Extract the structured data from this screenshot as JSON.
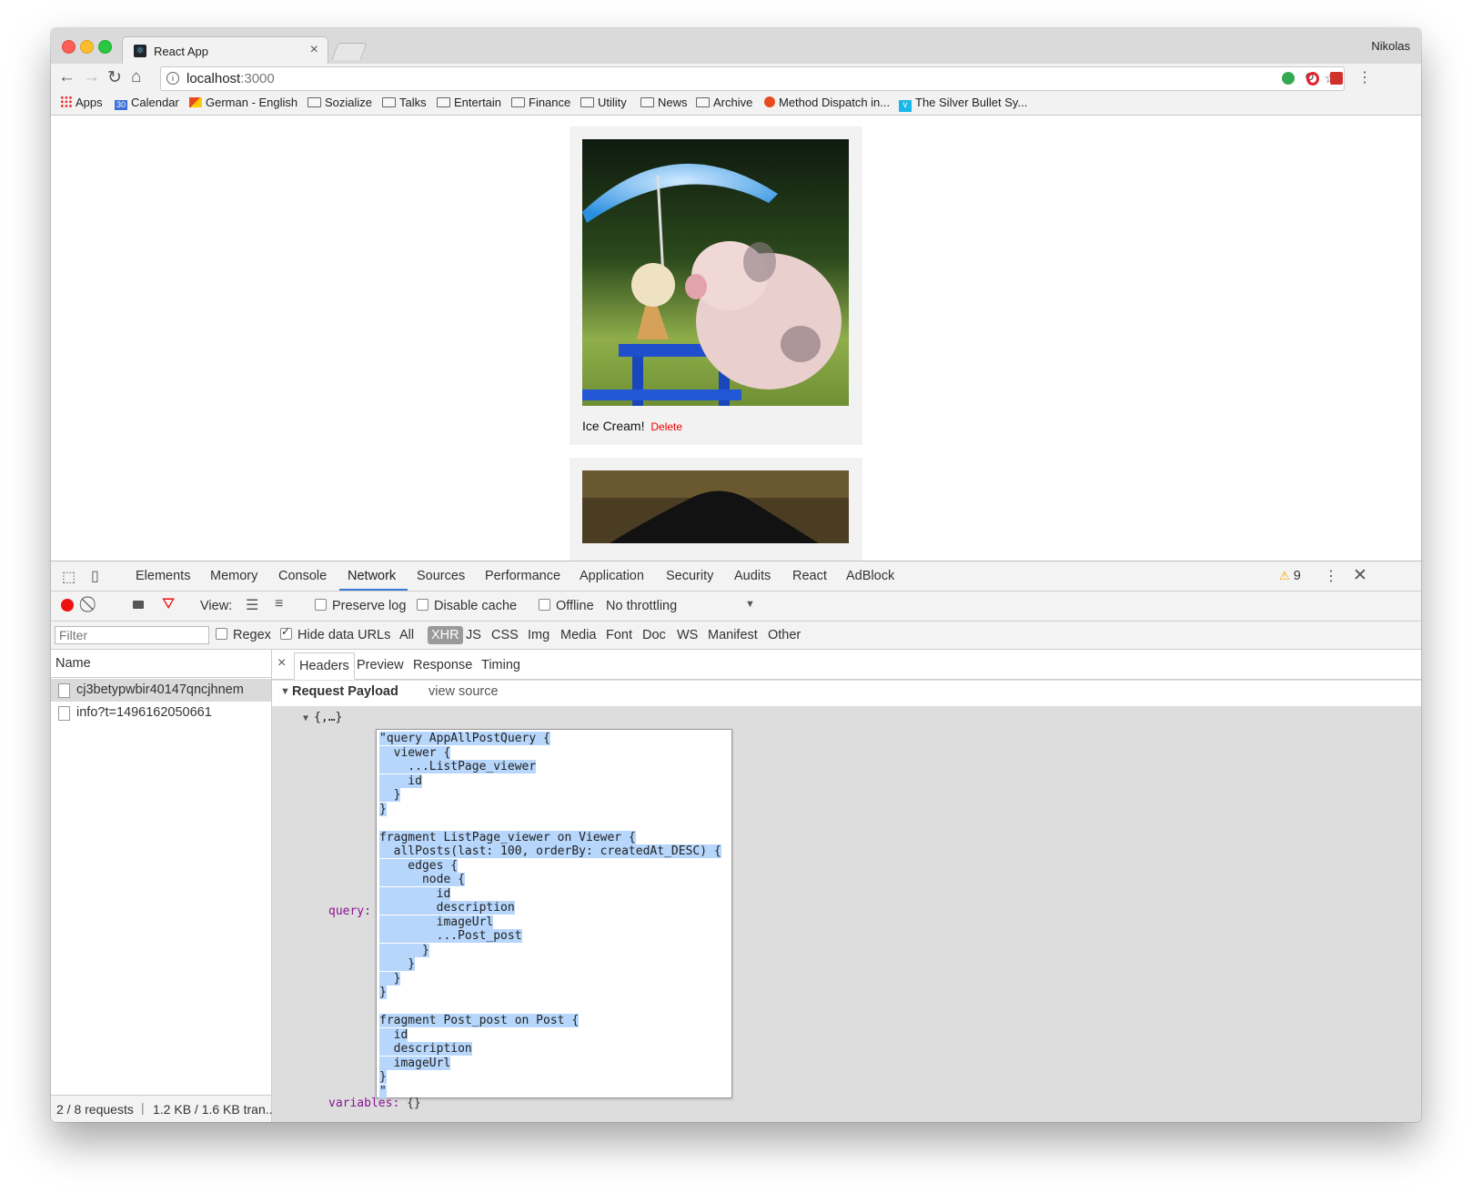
{
  "browser": {
    "tab_title": "React App",
    "profile_name": "Nikolas",
    "url_host": "localhost",
    "url_port": ":3000",
    "bookmarks": [
      {
        "label": "Apps",
        "icon": "apps-grid-icon"
      },
      {
        "label": "Calendar",
        "icon": "calendar-icon"
      },
      {
        "label": "German - English",
        "icon": "dictionary-icon"
      },
      {
        "label": "Sozialize",
        "icon": "folder-icon"
      },
      {
        "label": "Talks",
        "icon": "folder-icon"
      },
      {
        "label": "Entertain",
        "icon": "folder-icon"
      },
      {
        "label": "Finance",
        "icon": "folder-icon"
      },
      {
        "label": "Utility",
        "icon": "folder-icon"
      },
      {
        "label": "News",
        "icon": "folder-icon"
      },
      {
        "label": "Archive",
        "icon": "folder-icon"
      },
      {
        "label": "Method Dispatch in...",
        "icon": "site-icon"
      },
      {
        "label": "The Silver Bullet Sy...",
        "icon": "vimeo-icon"
      }
    ],
    "calendar_badge": "30"
  },
  "page": {
    "posts": [
      {
        "description": "Ice Cream!",
        "delete_label": "Delete"
      }
    ]
  },
  "devtools": {
    "tabs": [
      "Elements",
      "Memory",
      "Console",
      "Network",
      "Sources",
      "Performance",
      "Application",
      "Security",
      "Audits",
      "React",
      "AdBlock"
    ],
    "active_tab": "Network",
    "warning_count": "9",
    "view_label": "View:",
    "preserve_log_label": "Preserve log",
    "disable_cache_label": "Disable cache",
    "offline_label": "Offline",
    "throttling_value": "No throttling",
    "filter_placeholder": "Filter",
    "regex_label": "Regex",
    "hide_data_urls_label": "Hide data URLs",
    "type_filters": [
      "All",
      "XHR",
      "JS",
      "CSS",
      "Img",
      "Media",
      "Font",
      "Doc",
      "WS",
      "Manifest",
      "Other"
    ],
    "active_type_filter": "XHR",
    "name_header": "Name",
    "requests": [
      "cj3betypwbir40147qncjhnem",
      "info?t=1496162050661"
    ],
    "status_requests": "2 / 8 requests",
    "status_transfer": "1.2 KB / 1.6 KB tran...",
    "detail_tabs": [
      "Headers",
      "Preview",
      "Response",
      "Timing"
    ],
    "active_detail_tab": "Headers",
    "payload_title": "Request Payload",
    "view_source_label": "view source",
    "object_summary": "{,…}",
    "query_key": "query:",
    "query_lines": [
      "\"query AppAllPostQuery {",
      "  viewer {",
      "    ...ListPage_viewer",
      "    id",
      "  }",
      "}",
      "",
      "fragment ListPage_viewer on Viewer {",
      "  allPosts(last: 100, orderBy: createdAt_DESC) {",
      "    edges {",
      "      node {",
      "        id",
      "        description",
      "        imageUrl",
      "        ...Post_post",
      "      }",
      "    }",
      "  }",
      "}",
      "",
      "fragment Post_post on Post {",
      "  id",
      "  description",
      "  imageUrl",
      "}",
      "\""
    ],
    "variables_key": "variables:",
    "variables_value": "{}"
  }
}
